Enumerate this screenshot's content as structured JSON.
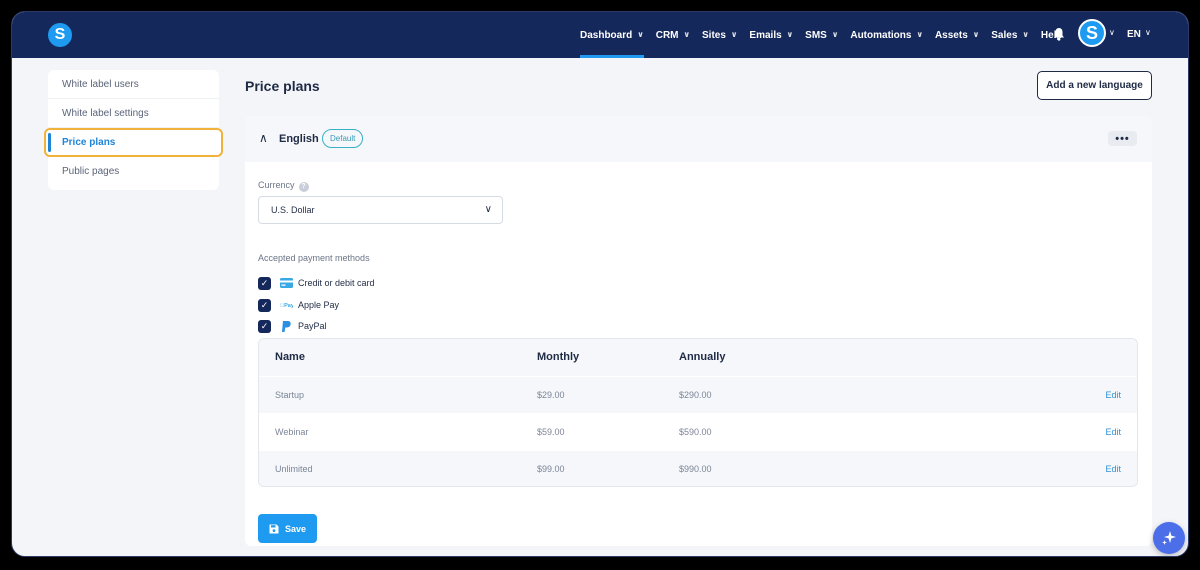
{
  "brand": {
    "logo_letter": "S",
    "accent": "#1e9bf0",
    "nav_bg": "#14285b"
  },
  "nav": {
    "items": [
      {
        "label": "Dashboard",
        "has_chevron": true,
        "active": true
      },
      {
        "label": "CRM",
        "has_chevron": true
      },
      {
        "label": "Sites",
        "has_chevron": true
      },
      {
        "label": "Emails",
        "has_chevron": true
      },
      {
        "label": "SMS",
        "has_chevron": true
      },
      {
        "label": "Automations",
        "has_chevron": true
      },
      {
        "label": "Assets",
        "has_chevron": true
      },
      {
        "label": "Sales",
        "has_chevron": true
      },
      {
        "label": "Help",
        "has_chevron": false
      }
    ],
    "avatar_letter": "S",
    "language": "EN"
  },
  "sidebar": {
    "items": [
      {
        "label": "White label users"
      },
      {
        "label": "White label settings"
      },
      {
        "label": "Price plans",
        "active": true
      },
      {
        "label": "Public pages"
      }
    ]
  },
  "main": {
    "title": "Price plans",
    "add_language_label": "Add a new language",
    "panel": {
      "language": "English",
      "badge": "Default",
      "currency_label": "Currency",
      "currency_value": "U.S. Dollar",
      "payment_methods_label": "Accepted payment methods",
      "payment_methods": [
        {
          "label": "Credit or debit card",
          "checked": true,
          "icon": "credit-card-icon"
        },
        {
          "label": "Apple Pay",
          "checked": true,
          "icon": "apple-pay-icon"
        },
        {
          "label": "PayPal",
          "checked": true,
          "icon": "paypal-icon"
        }
      ],
      "table": {
        "headers": {
          "name": "Name",
          "monthly": "Monthly",
          "annually": "Annually"
        },
        "rows": [
          {
            "name": "Startup",
            "monthly": "$29.00",
            "annually": "$290.00",
            "action": "Edit"
          },
          {
            "name": "Webinar",
            "monthly": "$59.00",
            "annually": "$590.00",
            "action": "Edit"
          },
          {
            "name": "Unlimited",
            "monthly": "$99.00",
            "annually": "$990.00",
            "action": "Edit"
          }
        ]
      },
      "save_label": "Save"
    }
  }
}
